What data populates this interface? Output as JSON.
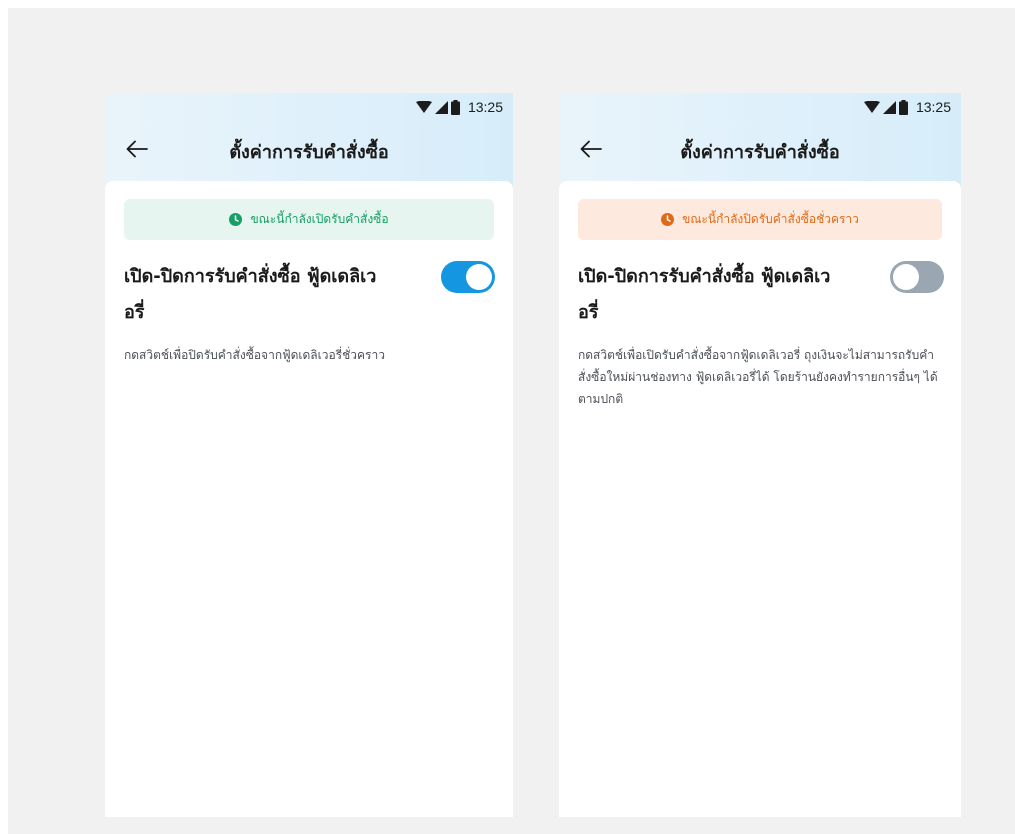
{
  "status_bar": {
    "time": "13:25"
  },
  "colors": {
    "accent_blue": "#1496e0",
    "open_green": "#16a066",
    "closed_orange": "#e16a19",
    "toggle_off": "#9aa7b2"
  },
  "screens": [
    {
      "title": "ตั้งค่าการรับคำสั่งซื้อ",
      "banner": {
        "text": "ขณะนี้กำลังเปิดรับคำสั่งซื้อ",
        "state": "open"
      },
      "toggle_title": "เปิด-ปิดการรับคำสั่งซื้อ ฟู้ดเดลิเวอรี่",
      "toggle_state": "on",
      "description": "กดสวิตช์เพื่อปิดรับคำสั่งซื้อจากฟู้ดเดลิเวอรี่ชั่วคราว"
    },
    {
      "title": "ตั้งค่าการรับคำสั่งซื้อ",
      "banner": {
        "text": "ขณะนี้กำลังปิดรับคำสั่งซื้อชั่วคราว",
        "state": "closed"
      },
      "toggle_title": "เปิด-ปิดการรับคำสั่งซื้อ ฟู้ดเดลิเวอรี่",
      "toggle_state": "off",
      "description": "กดสวิตช์เพื่อเปิดรับคำสั่งซื้อจากฟู้ดเดลิเวอรี่ ถุงเงินจะไม่สามารถรับคำสั่งซื้อใหม่ผ่านช่องทาง ฟู้ดเดลิเวอรี่ได้ โดยร้านยังคงทำรายการอื่นๆ ได้ตามปกติ"
    }
  ],
  "icons": {
    "back": "arrow-left-icon",
    "wifi": "wifi-icon",
    "signal": "signal-icon",
    "battery": "battery-icon",
    "clock": "clock-icon"
  }
}
